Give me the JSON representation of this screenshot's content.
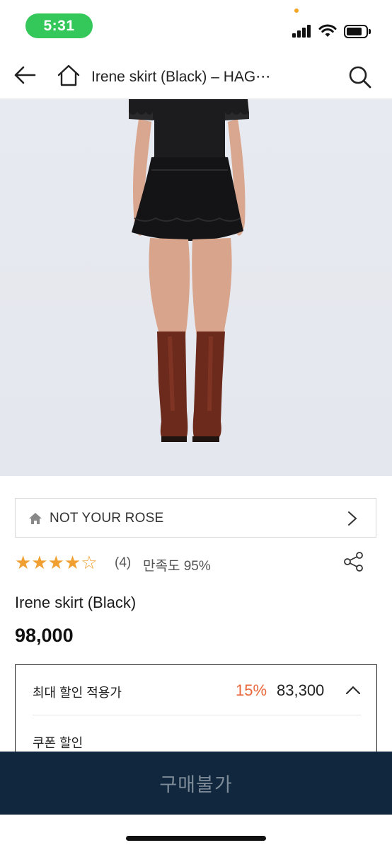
{
  "status_bar": {
    "time": "5:31",
    "icons": [
      "cellular-signal-icon",
      "wifi-icon",
      "battery-icon"
    ]
  },
  "nav": {
    "title": "Irene skirt (Black) – HAG⋯",
    "icons": [
      "back-arrow-icon",
      "home-icon",
      "search-icon"
    ]
  },
  "shop": {
    "name": "NOT YOUR ROSE"
  },
  "rating": {
    "stars": "★★★★☆",
    "value": 4,
    "max": 5,
    "review_count": "(4)",
    "satisfaction": "만족도 95%"
  },
  "product": {
    "name": "Irene skirt (Black)",
    "price": "98,000"
  },
  "discount": {
    "label": "최대 할인 적용가",
    "rate": "15%",
    "price": "83,300",
    "coupon_label": "쿠폰 할인"
  },
  "buy_button": {
    "label": "구매불가"
  },
  "colors": {
    "status_green": "#34c759",
    "star": "#f0a030",
    "discount_rate": "#e8663a",
    "buy_bar": "#10273d",
    "buy_label": "#7d8a97"
  }
}
